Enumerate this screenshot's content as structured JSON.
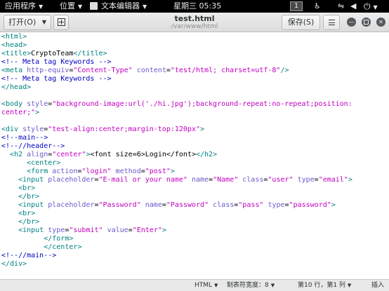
{
  "topbar": {
    "apps_label": "应用程序",
    "places_label": "位置",
    "editor_label": "文本编辑器",
    "clock": "星期三 05:35",
    "workspace": "1",
    "icons": [
      "accessibility-icon",
      "network-icon",
      "volume-icon",
      "power-icon"
    ]
  },
  "header": {
    "open_label": "打开(O)",
    "title": "test.html",
    "subtitle": "/var/www/html",
    "save_label": "保存(S)"
  },
  "editor": {
    "colors": {
      "tag": "#008080",
      "attr": "#6a5acd",
      "string": "#c000c0",
      "comment": "#0000c0"
    },
    "lines": [
      [
        [
          "t",
          "<html>"
        ]
      ],
      [
        [
          "t",
          "<head>"
        ]
      ],
      [
        [
          "t",
          "<title>"
        ],
        [
          "x",
          "CryptoTeam"
        ],
        [
          "t",
          "</title>"
        ]
      ],
      [
        [
          "c",
          "<!-- Meta tag Keywords -->"
        ]
      ],
      [
        [
          "t",
          "<meta "
        ],
        [
          "a",
          "http-equiv"
        ],
        [
          "x",
          "="
        ],
        [
          "s",
          "\"Content-Type\""
        ],
        [
          "x",
          " "
        ],
        [
          "a",
          "content"
        ],
        [
          "x",
          "="
        ],
        [
          "s",
          "\"test/html; charset=utf-8\""
        ],
        [
          "t",
          "/>"
        ]
      ],
      [
        [
          "c",
          "<!-- Meta tag Keywords -->"
        ]
      ],
      [
        [
          "t",
          "</head>"
        ]
      ],
      [],
      [
        [
          "t",
          "<body "
        ],
        [
          "a",
          "style"
        ],
        [
          "x",
          "="
        ],
        [
          "s",
          "\"background-image:url('./hi.jpg');background-repeat:no-repeat;position:"
        ]
      ],
      [
        [
          "s",
          "center;\""
        ],
        [
          "t",
          ">"
        ]
      ],
      [],
      [
        [
          "t",
          "<div "
        ],
        [
          "a",
          "style"
        ],
        [
          "x",
          "="
        ],
        [
          "s",
          "\"test-align:center;margin-top:120px\""
        ],
        [
          "t",
          ">"
        ]
      ],
      [
        [
          "c",
          "<!--main-->"
        ]
      ],
      [
        [
          "c",
          "<!--//header-->"
        ]
      ],
      [
        [
          "x",
          "  "
        ],
        [
          "t",
          "<h2 "
        ],
        [
          "a",
          "align"
        ],
        [
          "x",
          "="
        ],
        [
          "s",
          "\"center\""
        ],
        [
          "t",
          ">"
        ],
        [
          "x",
          "<font size=6>Login</font>"
        ],
        [
          "t",
          "</h2>"
        ]
      ],
      [
        [
          "x",
          "      "
        ],
        [
          "t",
          "<center>"
        ]
      ],
      [
        [
          "x",
          "      "
        ],
        [
          "t",
          "<form "
        ],
        [
          "a",
          "action"
        ],
        [
          "x",
          "="
        ],
        [
          "s",
          "\"login\""
        ],
        [
          "x",
          " "
        ],
        [
          "a",
          "method"
        ],
        [
          "x",
          "="
        ],
        [
          "s",
          "\"post\""
        ],
        [
          "t",
          ">"
        ]
      ],
      [
        [
          "x",
          "    "
        ],
        [
          "t",
          "<input "
        ],
        [
          "a",
          "placeholder"
        ],
        [
          "x",
          "="
        ],
        [
          "s",
          "\"E-mail or your name\""
        ],
        [
          "x",
          " "
        ],
        [
          "a",
          "name"
        ],
        [
          "x",
          "="
        ],
        [
          "s",
          "\"Name\""
        ],
        [
          "x",
          " "
        ],
        [
          "a",
          "class"
        ],
        [
          "x",
          "="
        ],
        [
          "s",
          "\"user\""
        ],
        [
          "x",
          " "
        ],
        [
          "a",
          "type"
        ],
        [
          "x",
          "="
        ],
        [
          "s",
          "\"email\""
        ],
        [
          "t",
          ">"
        ]
      ],
      [
        [
          "x",
          "    "
        ],
        [
          "t",
          "<br>"
        ]
      ],
      [
        [
          "x",
          "    "
        ],
        [
          "t",
          "</br>"
        ]
      ],
      [
        [
          "x",
          "    "
        ],
        [
          "t",
          "<input "
        ],
        [
          "a",
          "placeholder"
        ],
        [
          "x",
          "="
        ],
        [
          "s",
          "\"Password\""
        ],
        [
          "x",
          " "
        ],
        [
          "a",
          "name"
        ],
        [
          "x",
          "="
        ],
        [
          "s",
          "\"Password\""
        ],
        [
          "x",
          " "
        ],
        [
          "a",
          "class"
        ],
        [
          "x",
          "="
        ],
        [
          "s",
          "\"pass\""
        ],
        [
          "x",
          " "
        ],
        [
          "a",
          "type"
        ],
        [
          "x",
          "="
        ],
        [
          "s",
          "\"password\""
        ],
        [
          "t",
          ">"
        ]
      ],
      [
        [
          "x",
          "    "
        ],
        [
          "t",
          "<br>"
        ]
      ],
      [
        [
          "x",
          "    "
        ],
        [
          "t",
          "</br>"
        ]
      ],
      [
        [
          "x",
          "    "
        ],
        [
          "t",
          "<input "
        ],
        [
          "a",
          "type"
        ],
        [
          "x",
          "="
        ],
        [
          "s",
          "\"submit\""
        ],
        [
          "x",
          " "
        ],
        [
          "a",
          "value"
        ],
        [
          "x",
          "="
        ],
        [
          "s",
          "\"Enter\""
        ],
        [
          "t",
          ">"
        ]
      ],
      [
        [
          "x",
          "          "
        ],
        [
          "t",
          "</form>"
        ]
      ],
      [
        [
          "x",
          "          "
        ],
        [
          "t",
          "</center>"
        ]
      ],
      [
        [
          "c",
          "<!--//main-->"
        ]
      ],
      [
        [
          "t",
          "</div>"
        ]
      ]
    ]
  },
  "statusbar": {
    "language": "HTML",
    "tab_width": "制表符宽度：8",
    "position": "第10 行，第1 列",
    "mode": "插入"
  }
}
